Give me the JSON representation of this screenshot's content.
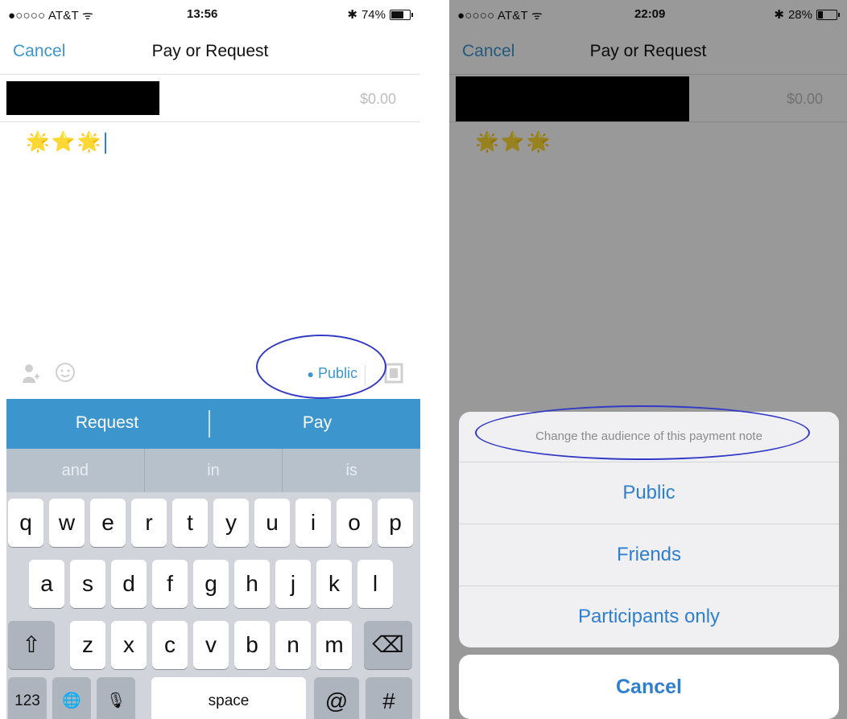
{
  "left": {
    "status": {
      "carrier": "●○○○○ AT&T ᯤ",
      "time": "13:56",
      "bluetooth": "✱",
      "battery_text": "74%",
      "battery_level": 0.74
    },
    "nav": {
      "cancel": "Cancel",
      "title": "Pay or Request"
    },
    "amount": "$0.00",
    "note": "🌟⭐🌟",
    "toolbar": {
      "audience": "Public",
      "audience_icon": "globe-icon",
      "contact_icon": "person-icon",
      "emoji_icon": "smiley-icon",
      "photo_icon": "photo-icon"
    },
    "actions": {
      "request": "Request",
      "pay": "Pay"
    },
    "suggestions": [
      "and",
      "in",
      "is"
    ],
    "keyboard": {
      "row1": [
        "q",
        "w",
        "e",
        "r",
        "t",
        "y",
        "u",
        "i",
        "o",
        "p"
      ],
      "row2": [
        "a",
        "s",
        "d",
        "f",
        "g",
        "h",
        "j",
        "k",
        "l"
      ],
      "row3": [
        "z",
        "x",
        "c",
        "v",
        "b",
        "n",
        "m"
      ],
      "shift": "⇧",
      "delete": "⌫",
      "numbers": "123",
      "globe": "🌐",
      "mic": "🎙",
      "space": "space",
      "at": "@",
      "hash": "#"
    }
  },
  "right": {
    "status": {
      "carrier": "●○○○○ AT&T ᯤ",
      "time": "22:09",
      "bluetooth": "✱",
      "battery_text": "28%",
      "battery_level": 0.28
    },
    "nav": {
      "cancel": "Cancel",
      "title": "Pay or Request"
    },
    "amount": "$0.00",
    "note": "🌟⭐🌟",
    "sheet": {
      "header": "Change the audience of this payment note",
      "options": [
        "Public",
        "Friends",
        "Participants only"
      ],
      "cancel": "Cancel"
    }
  }
}
